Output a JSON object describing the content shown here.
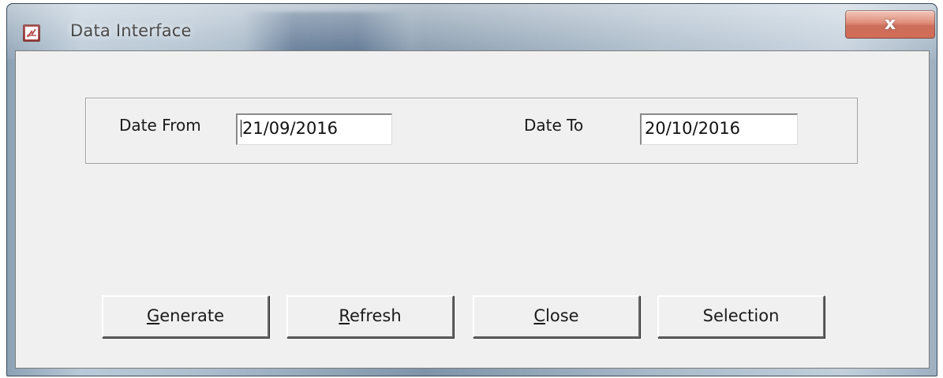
{
  "window": {
    "title": "Data Interface",
    "close_glyph": "x",
    "icon": "pdf-app-icon",
    "accent_color": "#a51d1d",
    "close_color": "#c8482a"
  },
  "form": {
    "date_from_label": "Date From",
    "date_from_value": "21/09/2016",
    "date_to_label": "Date To",
    "date_to_value": "20/10/2016"
  },
  "buttons": {
    "generate": {
      "mnemonic": "G",
      "rest": "enerate"
    },
    "refresh": {
      "mnemonic": "R",
      "rest": "efresh"
    },
    "close": {
      "mnemonic": "C",
      "rest": "lose"
    },
    "selection": {
      "label": "Selection"
    }
  }
}
